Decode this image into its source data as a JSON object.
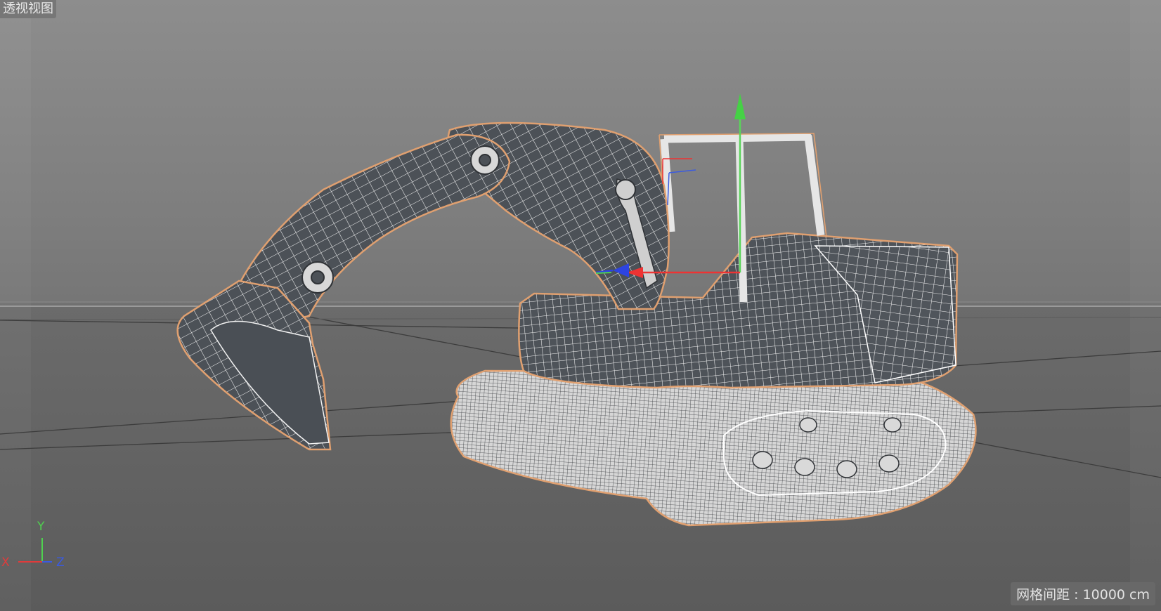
{
  "viewport": {
    "title": "透视视图",
    "grid_spacing_label": "网格间距 : 10000 cm"
  },
  "axis_indicator": {
    "x_label": "X",
    "y_label": "Y",
    "z_label": "Z",
    "x_color": "#e03b3b",
    "y_color": "#4fd04f",
    "z_color": "#3b5be0"
  },
  "scene": {
    "object": "excavator-wireframe",
    "selection_outline_color": "#e0a070",
    "wire_color": "#ffffff",
    "shade_color": "#4a4f55"
  }
}
